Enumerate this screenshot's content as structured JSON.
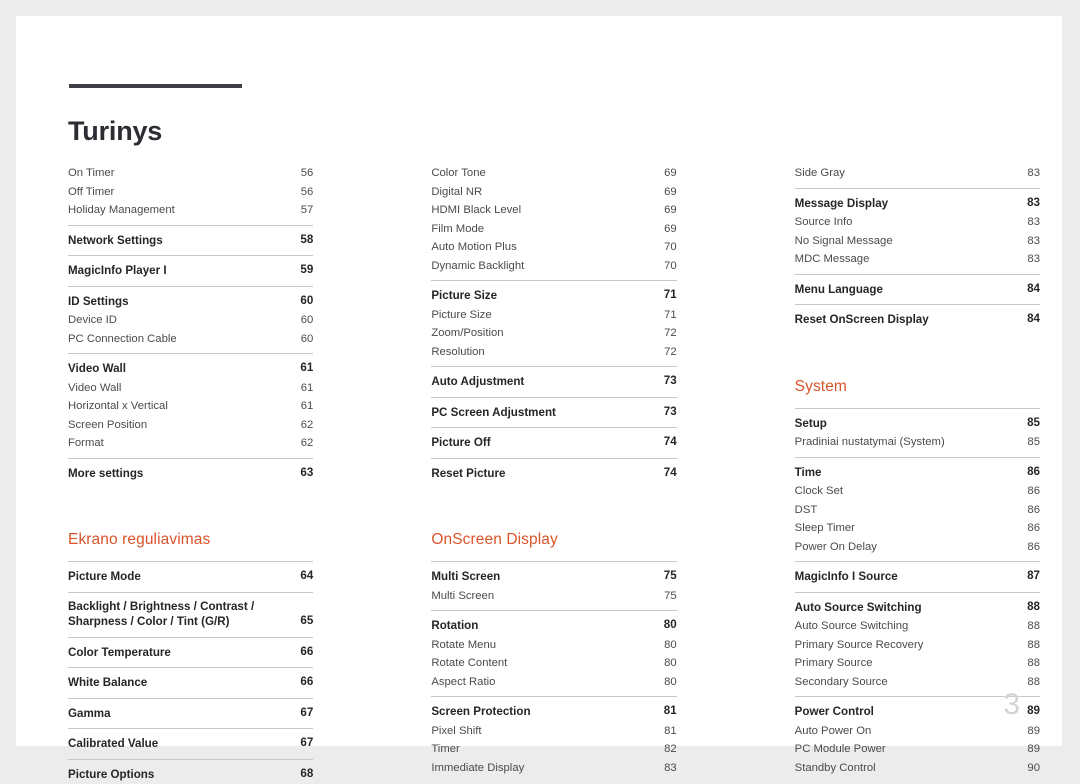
{
  "document": {
    "title": "Turinys",
    "folio": "3",
    "accent_color": "#d9542b",
    "rule_color": "#3f3f4a"
  },
  "columns": [
    {
      "groups": [
        {
          "heading": null,
          "entries": [
            {
              "label": "On Timer",
              "page": "56",
              "bold": false,
              "rule": false
            },
            {
              "label": "Off Timer",
              "page": "56",
              "bold": false,
              "rule": false
            },
            {
              "label": "Holiday Management",
              "page": "57",
              "bold": false,
              "rule": false
            },
            {
              "label": "Network Settings",
              "page": "58",
              "bold": true,
              "rule": true
            },
            {
              "label": "MagicInfo Player I",
              "page": "59",
              "bold": true,
              "rule": true
            },
            {
              "label": "ID Settings",
              "page": "60",
              "bold": true,
              "rule": true
            },
            {
              "label": "Device ID",
              "page": "60",
              "bold": false,
              "rule": false
            },
            {
              "label": "PC Connection Cable",
              "page": "60",
              "bold": false,
              "rule": false
            },
            {
              "label": "Video Wall",
              "page": "61",
              "bold": true,
              "rule": true
            },
            {
              "label": "Video Wall",
              "page": "61",
              "bold": false,
              "rule": false
            },
            {
              "label": "Horizontal x Vertical",
              "page": "61",
              "bold": false,
              "rule": false
            },
            {
              "label": "Screen Position",
              "page": "62",
              "bold": false,
              "rule": false
            },
            {
              "label": "Format",
              "page": "62",
              "bold": false,
              "rule": false
            },
            {
              "label": "More settings",
              "page": "63",
              "bold": true,
              "rule": true
            }
          ]
        },
        {
          "heading": "Ekrano reguliavimas",
          "entries": [
            {
              "label": "Picture Mode",
              "page": "64",
              "bold": true,
              "rule": true
            },
            {
              "label": "Backlight / Brightness / Contrast / Sharpness / Color / Tint (G/R)",
              "page": "65",
              "bold": true,
              "rule": true,
              "wrap": true
            },
            {
              "label": "Color Temperature",
              "page": "66",
              "bold": true,
              "rule": true
            },
            {
              "label": "White Balance",
              "page": "66",
              "bold": true,
              "rule": true
            },
            {
              "label": "Gamma",
              "page": "67",
              "bold": true,
              "rule": true
            },
            {
              "label": "Calibrated Value",
              "page": "67",
              "bold": true,
              "rule": true
            },
            {
              "label": "Picture Options",
              "page": "68",
              "bold": true,
              "rule": true
            }
          ]
        }
      ]
    },
    {
      "groups": [
        {
          "heading": null,
          "entries": [
            {
              "label": "Color Tone",
              "page": "69",
              "bold": false,
              "rule": false
            },
            {
              "label": "Digital NR",
              "page": "69",
              "bold": false,
              "rule": false
            },
            {
              "label": "HDMI Black Level",
              "page": "69",
              "bold": false,
              "rule": false
            },
            {
              "label": "Film Mode",
              "page": "69",
              "bold": false,
              "rule": false
            },
            {
              "label": "Auto Motion Plus",
              "page": "70",
              "bold": false,
              "rule": false
            },
            {
              "label": "Dynamic Backlight",
              "page": "70",
              "bold": false,
              "rule": false
            },
            {
              "label": "Picture Size",
              "page": "71",
              "bold": true,
              "rule": true
            },
            {
              "label": "Picture Size",
              "page": "71",
              "bold": false,
              "rule": false
            },
            {
              "label": "Zoom/Position",
              "page": "72",
              "bold": false,
              "rule": false
            },
            {
              "label": "Resolution",
              "page": "72",
              "bold": false,
              "rule": false
            },
            {
              "label": "Auto Adjustment",
              "page": "73",
              "bold": true,
              "rule": true
            },
            {
              "label": "PC Screen Adjustment",
              "page": "73",
              "bold": true,
              "rule": true
            },
            {
              "label": "Picture Off",
              "page": "74",
              "bold": true,
              "rule": true
            },
            {
              "label": "Reset Picture",
              "page": "74",
              "bold": true,
              "rule": true
            }
          ]
        },
        {
          "heading": "OnScreen Display",
          "entries": [
            {
              "label": "Multi Screen",
              "page": "75",
              "bold": true,
              "rule": true
            },
            {
              "label": "Multi Screen",
              "page": "75",
              "bold": false,
              "rule": false
            },
            {
              "label": "Rotation",
              "page": "80",
              "bold": true,
              "rule": true
            },
            {
              "label": "Rotate Menu",
              "page": "80",
              "bold": false,
              "rule": false
            },
            {
              "label": "Rotate Content",
              "page": "80",
              "bold": false,
              "rule": false
            },
            {
              "label": "Aspect Ratio",
              "page": "80",
              "bold": false,
              "rule": false
            },
            {
              "label": "Screen Protection",
              "page": "81",
              "bold": true,
              "rule": true
            },
            {
              "label": "Pixel Shift",
              "page": "81",
              "bold": false,
              "rule": false
            },
            {
              "label": "Timer",
              "page": "82",
              "bold": false,
              "rule": false
            },
            {
              "label": "Immediate Display",
              "page": "83",
              "bold": false,
              "rule": false
            }
          ]
        }
      ]
    },
    {
      "groups": [
        {
          "heading": null,
          "entries": [
            {
              "label": "Side Gray",
              "page": "83",
              "bold": false,
              "rule": false
            },
            {
              "label": "Message Display",
              "page": "83",
              "bold": true,
              "rule": true
            },
            {
              "label": "Source Info",
              "page": "83",
              "bold": false,
              "rule": false
            },
            {
              "label": "No Signal Message",
              "page": "83",
              "bold": false,
              "rule": false
            },
            {
              "label": "MDC Message",
              "page": "83",
              "bold": false,
              "rule": false
            },
            {
              "label": "Menu Language",
              "page": "84",
              "bold": true,
              "rule": true
            },
            {
              "label": "Reset OnScreen Display",
              "page": "84",
              "bold": true,
              "rule": true
            }
          ]
        },
        {
          "heading": "System",
          "entries": [
            {
              "label": "Setup",
              "page": "85",
              "bold": true,
              "rule": true
            },
            {
              "label": "Pradiniai nustatymai (System)",
              "page": "85",
              "bold": false,
              "rule": false
            },
            {
              "label": "Time",
              "page": "86",
              "bold": true,
              "rule": true
            },
            {
              "label": "Clock Set",
              "page": "86",
              "bold": false,
              "rule": false
            },
            {
              "label": "DST",
              "page": "86",
              "bold": false,
              "rule": false
            },
            {
              "label": "Sleep Timer",
              "page": "86",
              "bold": false,
              "rule": false
            },
            {
              "label": "Power On Delay",
              "page": "86",
              "bold": false,
              "rule": false
            },
            {
              "label": "MagicInfo I Source",
              "page": "87",
              "bold": true,
              "rule": true
            },
            {
              "label": "Auto Source Switching",
              "page": "88",
              "bold": true,
              "rule": true
            },
            {
              "label": "Auto Source Switching",
              "page": "88",
              "bold": false,
              "rule": false
            },
            {
              "label": "Primary Source Recovery",
              "page": "88",
              "bold": false,
              "rule": false
            },
            {
              "label": "Primary Source",
              "page": "88",
              "bold": false,
              "rule": false
            },
            {
              "label": "Secondary Source",
              "page": "88",
              "bold": false,
              "rule": false
            },
            {
              "label": "Power Control",
              "page": "89",
              "bold": true,
              "rule": true
            },
            {
              "label": "Auto Power On",
              "page": "89",
              "bold": false,
              "rule": false
            },
            {
              "label": "PC Module Power",
              "page": "89",
              "bold": false,
              "rule": false
            },
            {
              "label": "Standby Control",
              "page": "90",
              "bold": false,
              "rule": false
            }
          ]
        }
      ]
    }
  ]
}
